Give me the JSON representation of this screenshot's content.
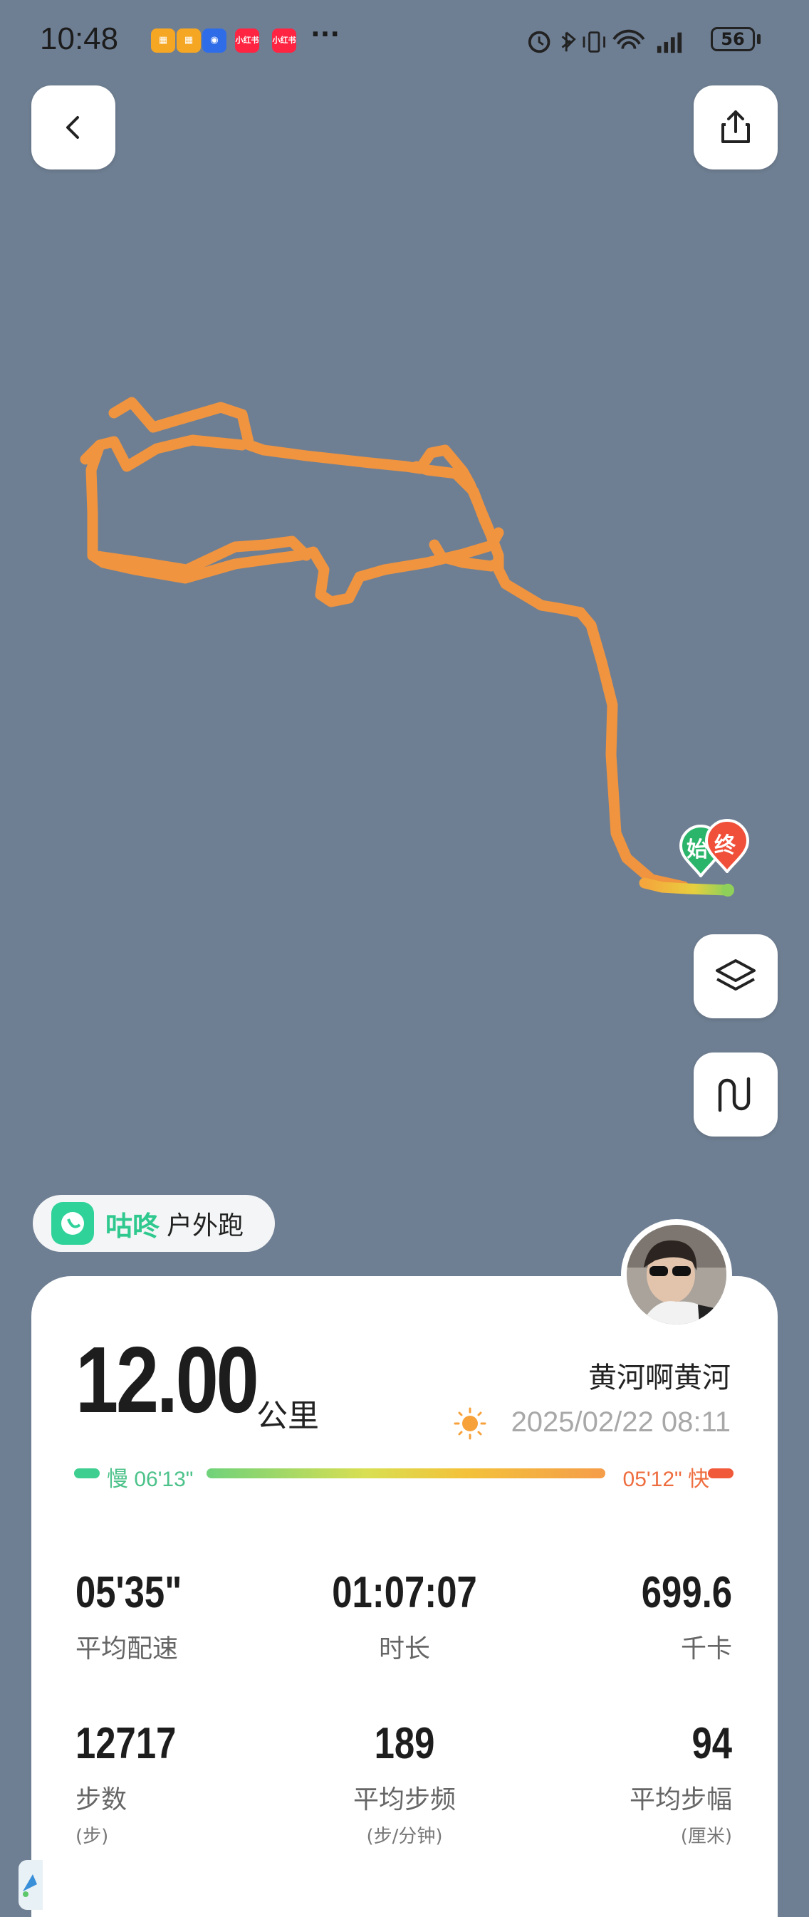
{
  "status_bar": {
    "time": "10:48",
    "notif_apps": [
      "小红书",
      "小红书"
    ],
    "more": "···",
    "battery": "56"
  },
  "map": {
    "start_marker": "始",
    "end_marker": "终"
  },
  "brand": {
    "name": "咕咚",
    "activity_type": "户外跑"
  },
  "workout": {
    "distance": "12.00",
    "distance_unit": "公里",
    "user_name": "黄河啊黄河",
    "datetime": "2025/02/22 08:11",
    "weather_icon": "sun-icon",
    "pace_range": {
      "slow_label": "慢 06'13\"",
      "fast_label": "05'12\" 快"
    }
  },
  "stats": [
    {
      "value": "05'35\"",
      "label": "平均配速",
      "unit": ""
    },
    {
      "value": "01:07:07",
      "label": "时长",
      "unit": ""
    },
    {
      "value": "699.6",
      "label": "千卡",
      "unit": ""
    },
    {
      "value": "12717",
      "label": "步数",
      "unit": "(步)"
    },
    {
      "value": "189",
      "label": "平均步频",
      "unit": "(步/分钟)"
    },
    {
      "value": "94",
      "label": "平均步幅",
      "unit": "(厘米)"
    }
  ],
  "colors": {
    "map_bg": "#6f7f93",
    "route": "#f0943f",
    "accent_green": "#2fc98f",
    "fast_red": "#f05a3a"
  }
}
